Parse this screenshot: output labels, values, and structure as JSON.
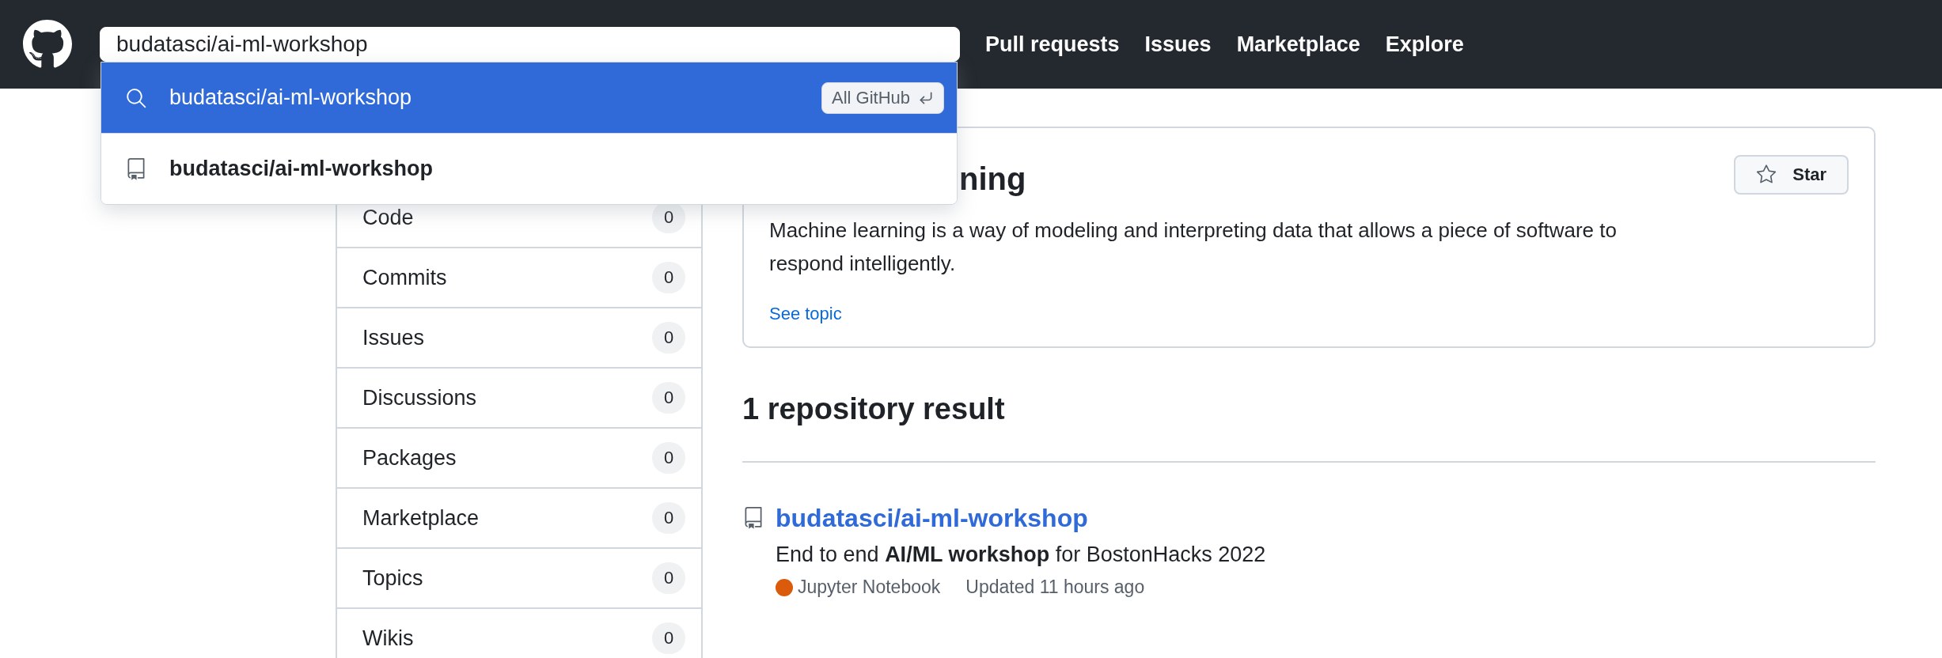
{
  "header": {
    "search_value": "budatasci/ai-ml-workshop",
    "nav": [
      "Pull requests",
      "Issues",
      "Marketplace",
      "Explore"
    ]
  },
  "suggestions": [
    {
      "kind": "search",
      "text": "budatasci/ai-ml-workshop",
      "badge": "All GitHub",
      "selected": true
    },
    {
      "kind": "repo",
      "text": "budatasci/ai-ml-workshop",
      "selected": false
    }
  ],
  "sidebar": {
    "items": [
      {
        "label": "Code",
        "count": "0"
      },
      {
        "label": "Commits",
        "count": "0"
      },
      {
        "label": "Issues",
        "count": "0"
      },
      {
        "label": "Discussions",
        "count": "0"
      },
      {
        "label": "Packages",
        "count": "0"
      },
      {
        "label": "Marketplace",
        "count": "0"
      },
      {
        "label": "Topics",
        "count": "0"
      },
      {
        "label": "Wikis",
        "count": "0"
      }
    ]
  },
  "topic": {
    "title": "ning",
    "description": "Machine learning is a way of modeling and interpreting data that allows a piece of software to respond intelligently.",
    "link": "See topic",
    "star": "Star"
  },
  "results": {
    "heading": "1 repository result",
    "items": [
      {
        "name": "budatasci/ai-ml-workshop",
        "description": "End to end **AI/ML workshop** for BostonHacks 2022",
        "language": "Jupyter Notebook",
        "color": "#da5b0b",
        "updated": "Updated 11 hours ago"
      }
    ]
  }
}
